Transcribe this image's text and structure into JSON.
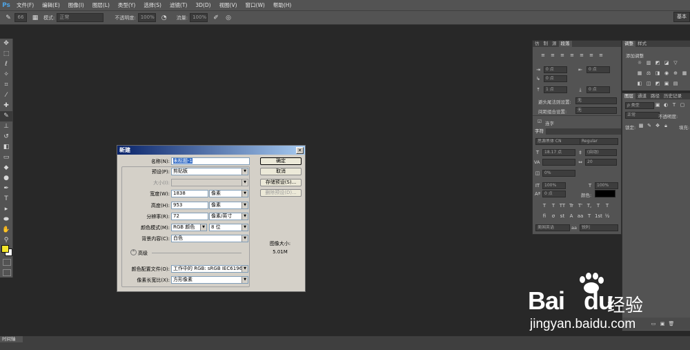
{
  "app_logo": "Ps",
  "menu": [
    "文件(F)",
    "编辑(E)",
    "图像(I)",
    "图层(L)",
    "类型(Y)",
    "选择(S)",
    "滤镜(T)",
    "3D(D)",
    "视图(V)",
    "窗口(W)",
    "帮助(H)"
  ],
  "options": {
    "brush_size": "66",
    "mode_label": "模式:",
    "mode_value": "正常",
    "opacity_label": "不透明度:",
    "opacity_value": "100%",
    "flow_label": "流量:",
    "flow_value": "100%",
    "workspace": "基本"
  },
  "dialog": {
    "title": "新建",
    "close": "✕",
    "name_label": "名称(N):",
    "name_value": "未标题-1",
    "preset_label": "预设(P):",
    "preset_value": "剪贴板",
    "size_label": "大小(I):",
    "width_label": "宽度(W):",
    "width_value": "1838",
    "width_unit": "像素",
    "height_label": "高度(H):",
    "height_value": "953",
    "height_unit": "像素",
    "resolution_label": "分辨率(R):",
    "resolution_value": "72",
    "resolution_unit": "像素/英寸",
    "color_mode_label": "颜色模式(M):",
    "color_mode_value": "RGB 颜色",
    "bit_depth": "8 位",
    "bg_label": "背景内容(C):",
    "bg_value": "白色",
    "advanced": "高级",
    "profile_label": "颜色配置文件(O):",
    "profile_value": "工作中的 RGB: sRGB IEC6196...",
    "aspect_label": "像素长宽比(X):",
    "aspect_value": "方形像素",
    "ok": "确定",
    "cancel": "取消",
    "save_preset": "存储预设(S)...",
    "delete_preset": "删除预设(D)...",
    "image_size_label": "图像大小:",
    "image_size_value": "5.01M"
  },
  "paragraph_panel": {
    "tabs": [
      "仿",
      "制",
      "源",
      "段落"
    ],
    "f1": "0 点",
    "f2": "0 点",
    "f3": "0 点",
    "f4": "0 点",
    "f5": "1 点",
    "f6": "0 点",
    "kinsoku_label": "避头尾法则设置:",
    "kinsoku_value": "无",
    "mojikumi_label": "间距组合设置:",
    "mojikumi_value": "无",
    "hyphen": "连字"
  },
  "char_panel": {
    "tab": "字符",
    "font_family": "思源黑体 CN",
    "font_style": "Regular",
    "size": "18.17 点",
    "leading": "(自动)",
    "kerning_label": "VA",
    "tracking": "20",
    "scale_pct": "0%",
    "vscale": "100%",
    "hscale": "100%",
    "baseline": "0 点",
    "color_label": "颜色:",
    "type_buttons": [
      "T",
      "T",
      "TT",
      "Tr",
      "T'",
      "T,",
      "T",
      "T"
    ],
    "ot_buttons": [
      "fi",
      "σ",
      "st",
      "A",
      "aa",
      "T",
      "1st",
      "½"
    ],
    "language": "美国英语",
    "aa_label": "aa",
    "aa_value": "锐利"
  },
  "adjust_panel": {
    "tabs": [
      "调整",
      "样式"
    ],
    "title": "添加调整"
  },
  "layers_panel": {
    "tabs": [
      "图层",
      "通道",
      "路径",
      "历史记录"
    ],
    "kind_label": "ρ 类型",
    "blend": "正常",
    "opacity_label": "不透明度:",
    "lock_label": "锁定:",
    "fill_label": "填充:"
  },
  "timeline": "时间轴",
  "watermark": {
    "logo_a": "Bai",
    "logo_b": "du",
    "cn": "经验",
    "url": "jingyan.baidu.com"
  }
}
